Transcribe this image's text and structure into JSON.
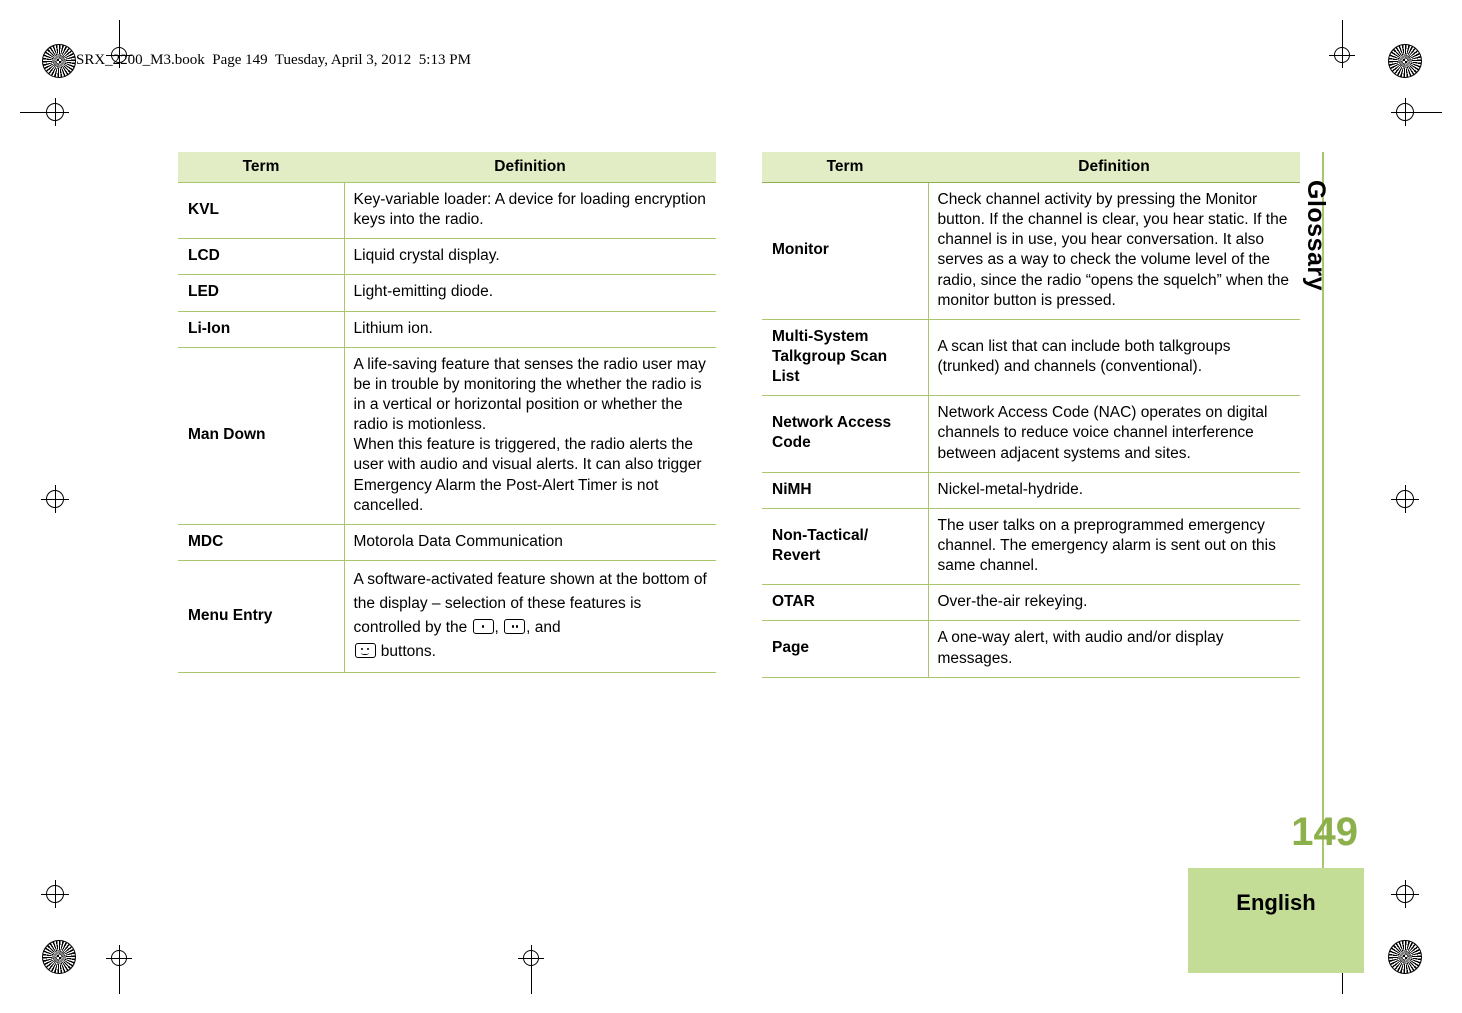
{
  "header": {
    "text": "SRX_2200_M3.book  Page 149  Tuesday, April 3, 2012  5:13 PM"
  },
  "side": {
    "glossary_tab": "Glossary",
    "page_number": "149",
    "language": "English"
  },
  "tables": [
    {
      "id": "left",
      "columns": [
        "Term",
        "Definition"
      ],
      "rows": [
        {
          "term": "KVL",
          "definition": "Key-variable loader: A device for loading encryption keys into the radio."
        },
        {
          "term": "LCD",
          "definition": "Liquid crystal display."
        },
        {
          "term": "LED",
          "definition": "Light-emitting diode."
        },
        {
          "term": "Li-Ion",
          "definition": "Lithium ion."
        },
        {
          "term": "Man Down",
          "definition": "A life-saving feature that senses the radio user may be in trouble by monitoring the whether the radio is in a vertical or horizontal position or whether the radio is motionless.\nWhen this feature is triggered, the radio alerts the user with audio and visual alerts. It can also trigger Emergency Alarm the Post-Alert Timer is not cancelled."
        },
        {
          "term": "MDC",
          "definition": "Motorola Data Communication"
        },
        {
          "term": "Menu Entry",
          "definition_prefix": "A software-activated feature shown at the bottom of the display – selection of these features is controlled by the ",
          "definition_middle": ", ",
          "definition_suffix": ", and ",
          "definition_end": " buttons.",
          "icons": [
            "one-dot-button-icon",
            "two-dot-button-icon",
            "smile-button-icon"
          ]
        }
      ]
    },
    {
      "id": "right",
      "columns": [
        "Term",
        "Definition"
      ],
      "rows": [
        {
          "term": "Monitor",
          "definition": "Check channel activity by pressing the Monitor button. If the channel is clear, you hear static. If the channel is in use, you hear conversation. It also serves as a way to check the volume level of the radio, since the radio “opens the squelch” when the monitor button is pressed."
        },
        {
          "term": "Multi-System Talkgroup Scan List",
          "definition": "A scan list that can include both talkgroups (trunked) and channels (conventional)."
        },
        {
          "term": "Network Access Code",
          "definition": "Network Access Code (NAC) operates on digital channels to reduce voice channel interference between adjacent systems and sites."
        },
        {
          "term": "NiMH",
          "definition": "Nickel-metal-hydride."
        },
        {
          "term": "Non-Tactical/ Revert",
          "definition": "The user talks on a preprogrammed emergency channel. The emergency alarm is sent out on this same channel."
        },
        {
          "term": "OTAR",
          "definition": "Over-the-air rekeying."
        },
        {
          "term": "Page",
          "definition": "A one-way alert, with audio and/or display messages."
        }
      ]
    }
  ],
  "colors": {
    "header_bg": "#e2edc6",
    "rule": "#a8c66c",
    "accent": "#8cb04a",
    "lang_bg": "#c3dd96"
  }
}
